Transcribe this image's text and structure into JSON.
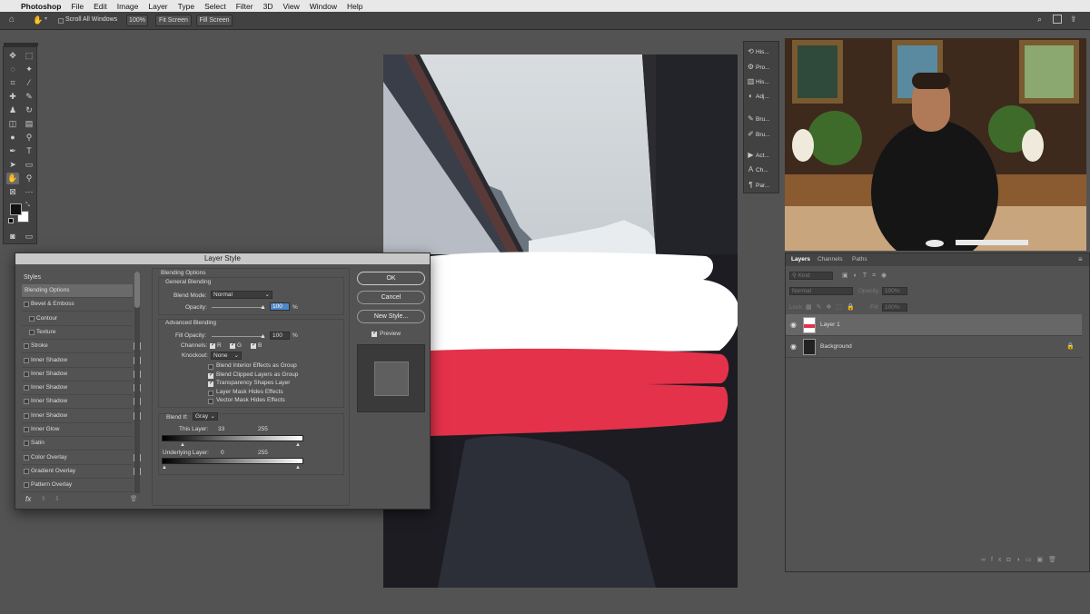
{
  "menubar": {
    "app_name": "Photoshop",
    "items": [
      "File",
      "Edit",
      "Image",
      "Layer",
      "Type",
      "Select",
      "Filter",
      "3D",
      "View",
      "Window",
      "Help"
    ]
  },
  "options_bar": {
    "scroll_all_windows": "Scroll All Windows",
    "zoom_100": "100%",
    "fit_screen": "Fit Screen",
    "fill_screen": "Fill Screen"
  },
  "dialog": {
    "title": "Layer Style",
    "styles_header": "Styles",
    "styles": [
      {
        "label": "Blending Options",
        "checkbox": false,
        "plus": false,
        "selected": true
      },
      {
        "label": "Bevel & Emboss",
        "checkbox": true,
        "plus": false
      },
      {
        "label": "Contour",
        "checkbox": true,
        "plus": false,
        "indent": true
      },
      {
        "label": "Texture",
        "checkbox": true,
        "plus": false,
        "indent": true
      },
      {
        "label": "Stroke",
        "checkbox": true,
        "plus": true
      },
      {
        "label": "Inner Shadow",
        "checkbox": true,
        "plus": true
      },
      {
        "label": "Inner Shadow",
        "checkbox": true,
        "plus": true
      },
      {
        "label": "Inner Shadow",
        "checkbox": true,
        "plus": true
      },
      {
        "label": "Inner Shadow",
        "checkbox": true,
        "plus": true
      },
      {
        "label": "Inner Shadow",
        "checkbox": true,
        "plus": true
      },
      {
        "label": "Inner Glow",
        "checkbox": true,
        "plus": false
      },
      {
        "label": "Satin",
        "checkbox": true,
        "plus": false
      },
      {
        "label": "Color Overlay",
        "checkbox": true,
        "plus": true
      },
      {
        "label": "Gradient Overlay",
        "checkbox": true,
        "plus": true
      },
      {
        "label": "Pattern Overlay",
        "checkbox": true,
        "plus": false
      }
    ],
    "fx_label": "fx",
    "blending_options_title": "Blending Options",
    "general_blending_title": "General Blending",
    "blend_mode_label": "Blend Mode:",
    "blend_mode_value": "Normal",
    "opacity_label": "Opacity:",
    "opacity_value": "100",
    "percent": "%",
    "advanced_blending_title": "Advanced Blending",
    "fill_opacity_label": "Fill Opacity:",
    "fill_opacity_value": "100",
    "channels_label": "Channels:",
    "channel_r": "R",
    "channel_g": "G",
    "channel_b": "B",
    "knockout_label": "Knockout:",
    "knockout_value": "None",
    "options": [
      {
        "label": "Blend Interior Effects as Group",
        "checked": false
      },
      {
        "label": "Blend Clipped Layers as Group",
        "checked": true
      },
      {
        "label": "Transparency Shapes Layer",
        "checked": true
      },
      {
        "label": "Layer Mask Hides Effects",
        "checked": false
      },
      {
        "label": "Vector Mask Hides Effects",
        "checked": false
      }
    ],
    "blend_if_label": "Blend If:",
    "blend_if_value": "Gray",
    "this_layer_label": "This Layer:",
    "this_layer_low": "33",
    "this_layer_high": "255",
    "underlying_label": "Underlying Layer:",
    "underlying_low": "0",
    "underlying_high": "255",
    "ok": "OK",
    "cancel": "Cancel",
    "new_style": "New Style...",
    "preview": "Preview"
  },
  "panel_icons": [
    {
      "icon": "history-icon",
      "label": "His..."
    },
    {
      "icon": "properties-icon",
      "label": "Pro..."
    },
    {
      "icon": "histogram-icon",
      "label": "His..."
    },
    {
      "icon": "adjustments-icon",
      "label": "Adj..."
    },
    {
      "icon": "brush-icon",
      "label": "Bru..."
    },
    {
      "icon": "brush-settings-icon",
      "label": "Bru..."
    },
    {
      "icon": "actions-icon",
      "label": "Act..."
    },
    {
      "icon": "character-icon",
      "label": "Ch..."
    },
    {
      "icon": "paragraph-icon",
      "label": "Par..."
    }
  ],
  "layers_panel": {
    "tabs": [
      "Layers",
      "Channels",
      "Paths"
    ],
    "kind_placeholder": "Kind",
    "blend_mode": "Normal",
    "opacity_label": "Opacity:",
    "opacity_value": "100%",
    "lock_label": "Lock:",
    "fill_label": "Fill:",
    "fill_value": "100%",
    "layers": [
      {
        "name": "Layer 1",
        "selected": true
      },
      {
        "name": "Background",
        "locked": true
      }
    ]
  },
  "colors": {
    "canvas_red": "#e3324a",
    "ui_dark": "#424242",
    "ui_mid": "#535353",
    "selection": "#676767"
  }
}
